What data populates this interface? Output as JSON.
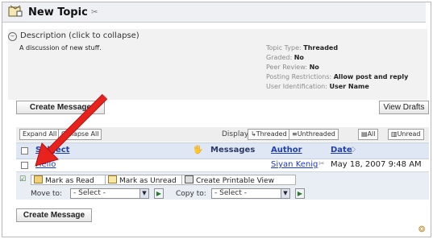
{
  "page": {
    "title": "New Topic",
    "title_extra": "✂"
  },
  "description": {
    "header": "Description (click to collapse)",
    "text": "A discussion of new stuff.",
    "properties": [
      {
        "label": "Topic Type:",
        "value": "Threaded"
      },
      {
        "label": "Graded:",
        "value": "No"
      },
      {
        "label": "Peer Review:",
        "value": "No"
      },
      {
        "label": "Posting Restrictions:",
        "value": "Allow post and reply"
      },
      {
        "label": "User Identification:",
        "value": "User Name"
      }
    ]
  },
  "buttons": {
    "create_message_top": "Create Message",
    "view_drafts": "View Drafts",
    "create_message_bottom": "Create Message"
  },
  "toolbar": {
    "expand_all": "Expand All",
    "collapse_all": "Collapse All",
    "display_label": "Display:",
    "threaded": "Threaded",
    "unthreaded": "Unthreaded",
    "all": "All",
    "unread": "Unread"
  },
  "table": {
    "col_subject": "Subject",
    "col_messages": "Messages",
    "col_author": "Author",
    "col_date": "Date",
    "rows": [
      {
        "subject": "Hello",
        "author": "Siyan Kenig",
        "date": "May 18, 2007 9:48 AM"
      }
    ]
  },
  "actions": {
    "mark_read": "Mark as Read",
    "mark_unread": "Mark as Unread",
    "printable": "Create Printable View",
    "move_to_label": "Move to:",
    "move_to_value": "- Select -",
    "copy_to_label": "Copy to:",
    "copy_to_value": "- Select -"
  },
  "colors": {
    "link": "#1b39c8",
    "arrow": "#e8231d",
    "header_bg": "#dfe7f4"
  }
}
